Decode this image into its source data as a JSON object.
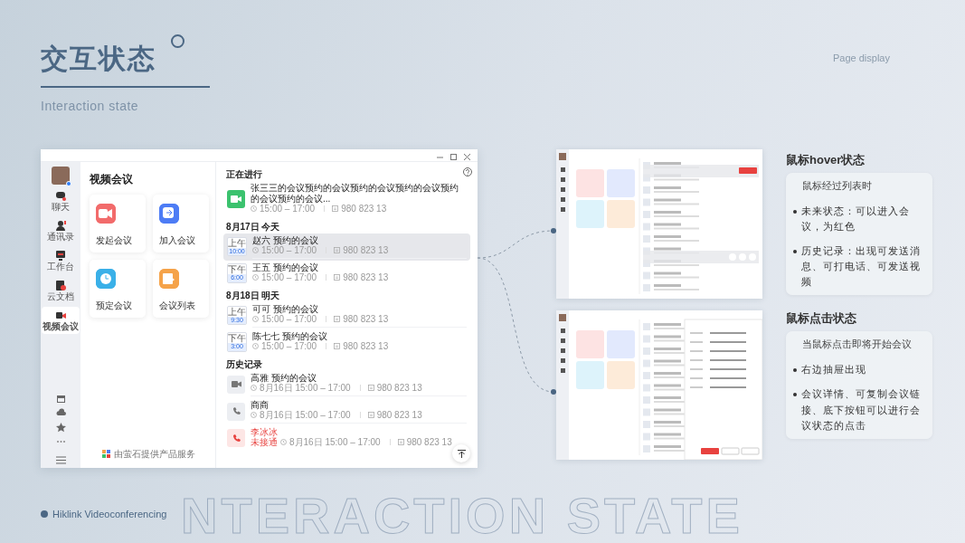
{
  "slide": {
    "title": "交互状态",
    "subtitle": "Interaction state",
    "page_label": "Page display",
    "footer": "Hiklink Videoconferencing",
    "bg_text": "NTERACTION STATE"
  },
  "app": {
    "nav": [
      {
        "label": "聊天",
        "selected": false
      },
      {
        "label": "通讯录",
        "selected": false
      },
      {
        "label": "工作台",
        "selected": false
      },
      {
        "label": "云文档",
        "selected": false
      },
      {
        "label": "视频会议",
        "selected": true
      }
    ],
    "panel_title": "视频会议",
    "actions": [
      {
        "label": "发起会议",
        "color": "#f26b6b"
      },
      {
        "label": "加入会议",
        "color": "#4d7cf5"
      },
      {
        "label": "预定会议",
        "color": "#3ab0e8"
      },
      {
        "label": "会议列表",
        "color": "#f5a34a"
      }
    ],
    "provider": "由萤石提供产品服务",
    "sections": [
      {
        "title": "正在进行",
        "items": [
          {
            "kind": "live",
            "title": "张三三的会议预约的会议预约的会议预约的会议预约的会议预约的会议...",
            "time": "15:00 – 17:00",
            "number": "980 823 13",
            "selected": false
          }
        ]
      },
      {
        "title": "8月17日 今天",
        "items": [
          {
            "kind": "scheduled",
            "period": "上午",
            "clock": "10:00",
            "title": "赵六 预约的会议",
            "time": "15:00 – 17:00",
            "number": "980 823 13",
            "selected": true
          },
          {
            "kind": "scheduled",
            "period": "下午",
            "clock": "6:00",
            "title": "王五 预约的会议",
            "time": "15:00 – 17:00",
            "number": "980 823 13",
            "selected": false
          }
        ]
      },
      {
        "title": "8月18日 明天",
        "items": [
          {
            "kind": "scheduled",
            "period": "上午",
            "clock": "9:30",
            "title": "可可 预约的会议",
            "time": "15:00 – 17:00",
            "number": "980 823 13",
            "selected": false
          },
          {
            "kind": "scheduled",
            "period": "下午",
            "clock": "3:00",
            "title": "陈七七 预约的会议",
            "time": "15:00 – 17:00",
            "number": "980 823 13",
            "selected": false
          }
        ]
      },
      {
        "title": "历史记录",
        "items": [
          {
            "kind": "video",
            "title": "高雅 预约的会议",
            "time": "8月16日 15:00 – 17:00",
            "number": "980 823 13",
            "selected": false
          },
          {
            "kind": "call",
            "title": "商商",
            "time": "8月16日 15:00 – 17:00",
            "number": "980 823 13",
            "selected": false
          },
          {
            "kind": "missed",
            "title": "李冰冰",
            "status": "未接通",
            "time": "8月16日 15:00 – 17:00",
            "number": "980 823 13",
            "selected": false
          }
        ]
      }
    ]
  },
  "thumbnails": [
    {
      "kind": "hover"
    },
    {
      "kind": "drawer"
    }
  ],
  "notes": [
    {
      "title": "鼠标hover状态",
      "lead": "鼠标经过列表时",
      "bullets": [
        "未来状态：可以进入会议，为红色",
        "历史记录：出现可发送消息、可打电话、可发送视频"
      ]
    },
    {
      "title": "鼠标点击状态",
      "lead": "当鼠标点击即将开始会议",
      "bullets": [
        "右边抽屉出现",
        "会议详情、可复制会议链接、底下按钮可以进行会议状态的点击"
      ]
    }
  ]
}
